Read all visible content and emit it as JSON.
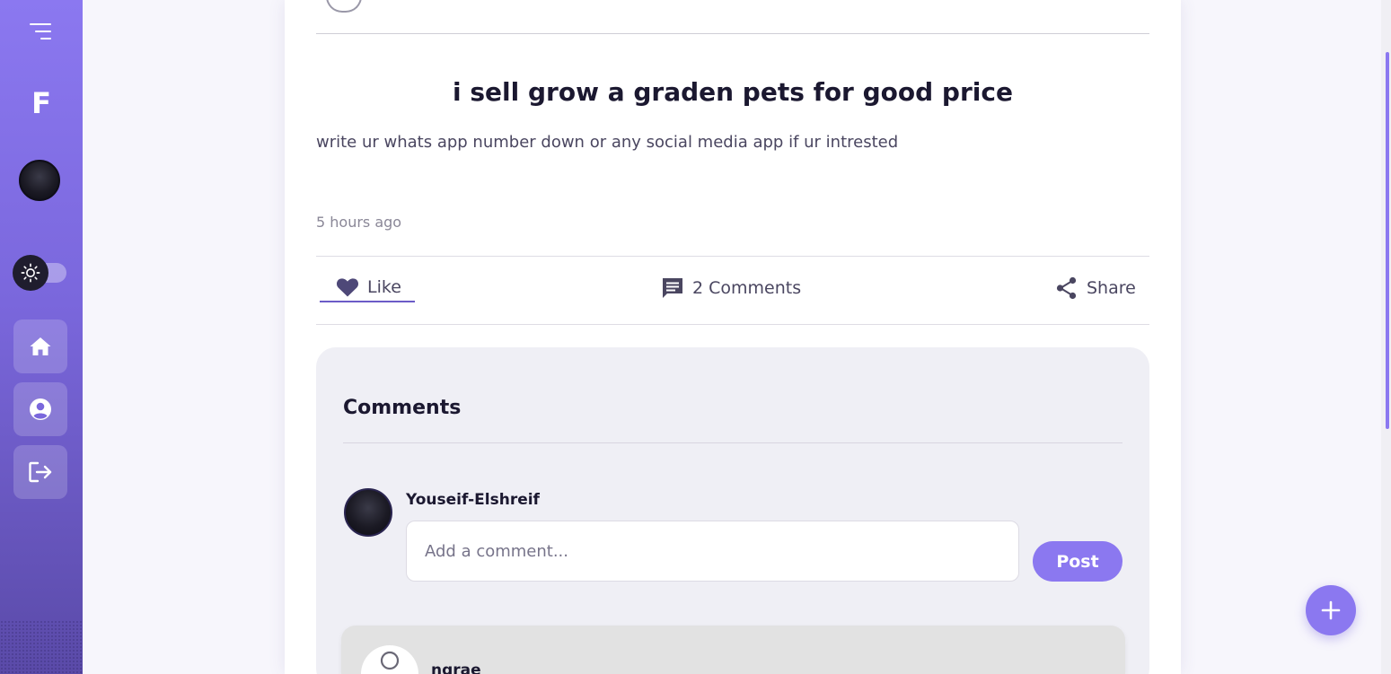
{
  "sidebar": {
    "brand": "F",
    "nav": [
      {
        "icon": "home-icon"
      },
      {
        "icon": "user-circle-icon"
      },
      {
        "icon": "logout-icon"
      }
    ],
    "theme": "light"
  },
  "post": {
    "title": "i sell grow a graden pets for good price",
    "body": "write ur whats app number down or any social media app if ur intrested",
    "time": "5 hours ago",
    "actions": {
      "like": "Like",
      "comments": "2 Comments",
      "share": "Share"
    }
  },
  "comments": {
    "heading": "Comments",
    "current_user": "Youseif-Elshreif",
    "input_placeholder": "Add a comment...",
    "post_label": "Post",
    "items": [
      {
        "user": "ngrae"
      }
    ]
  },
  "colors": {
    "accent": "#8b78f0",
    "sidebar_top": "#8b78f0",
    "sidebar_bottom": "#5a4aa8",
    "text_dark": "#1b1830"
  }
}
